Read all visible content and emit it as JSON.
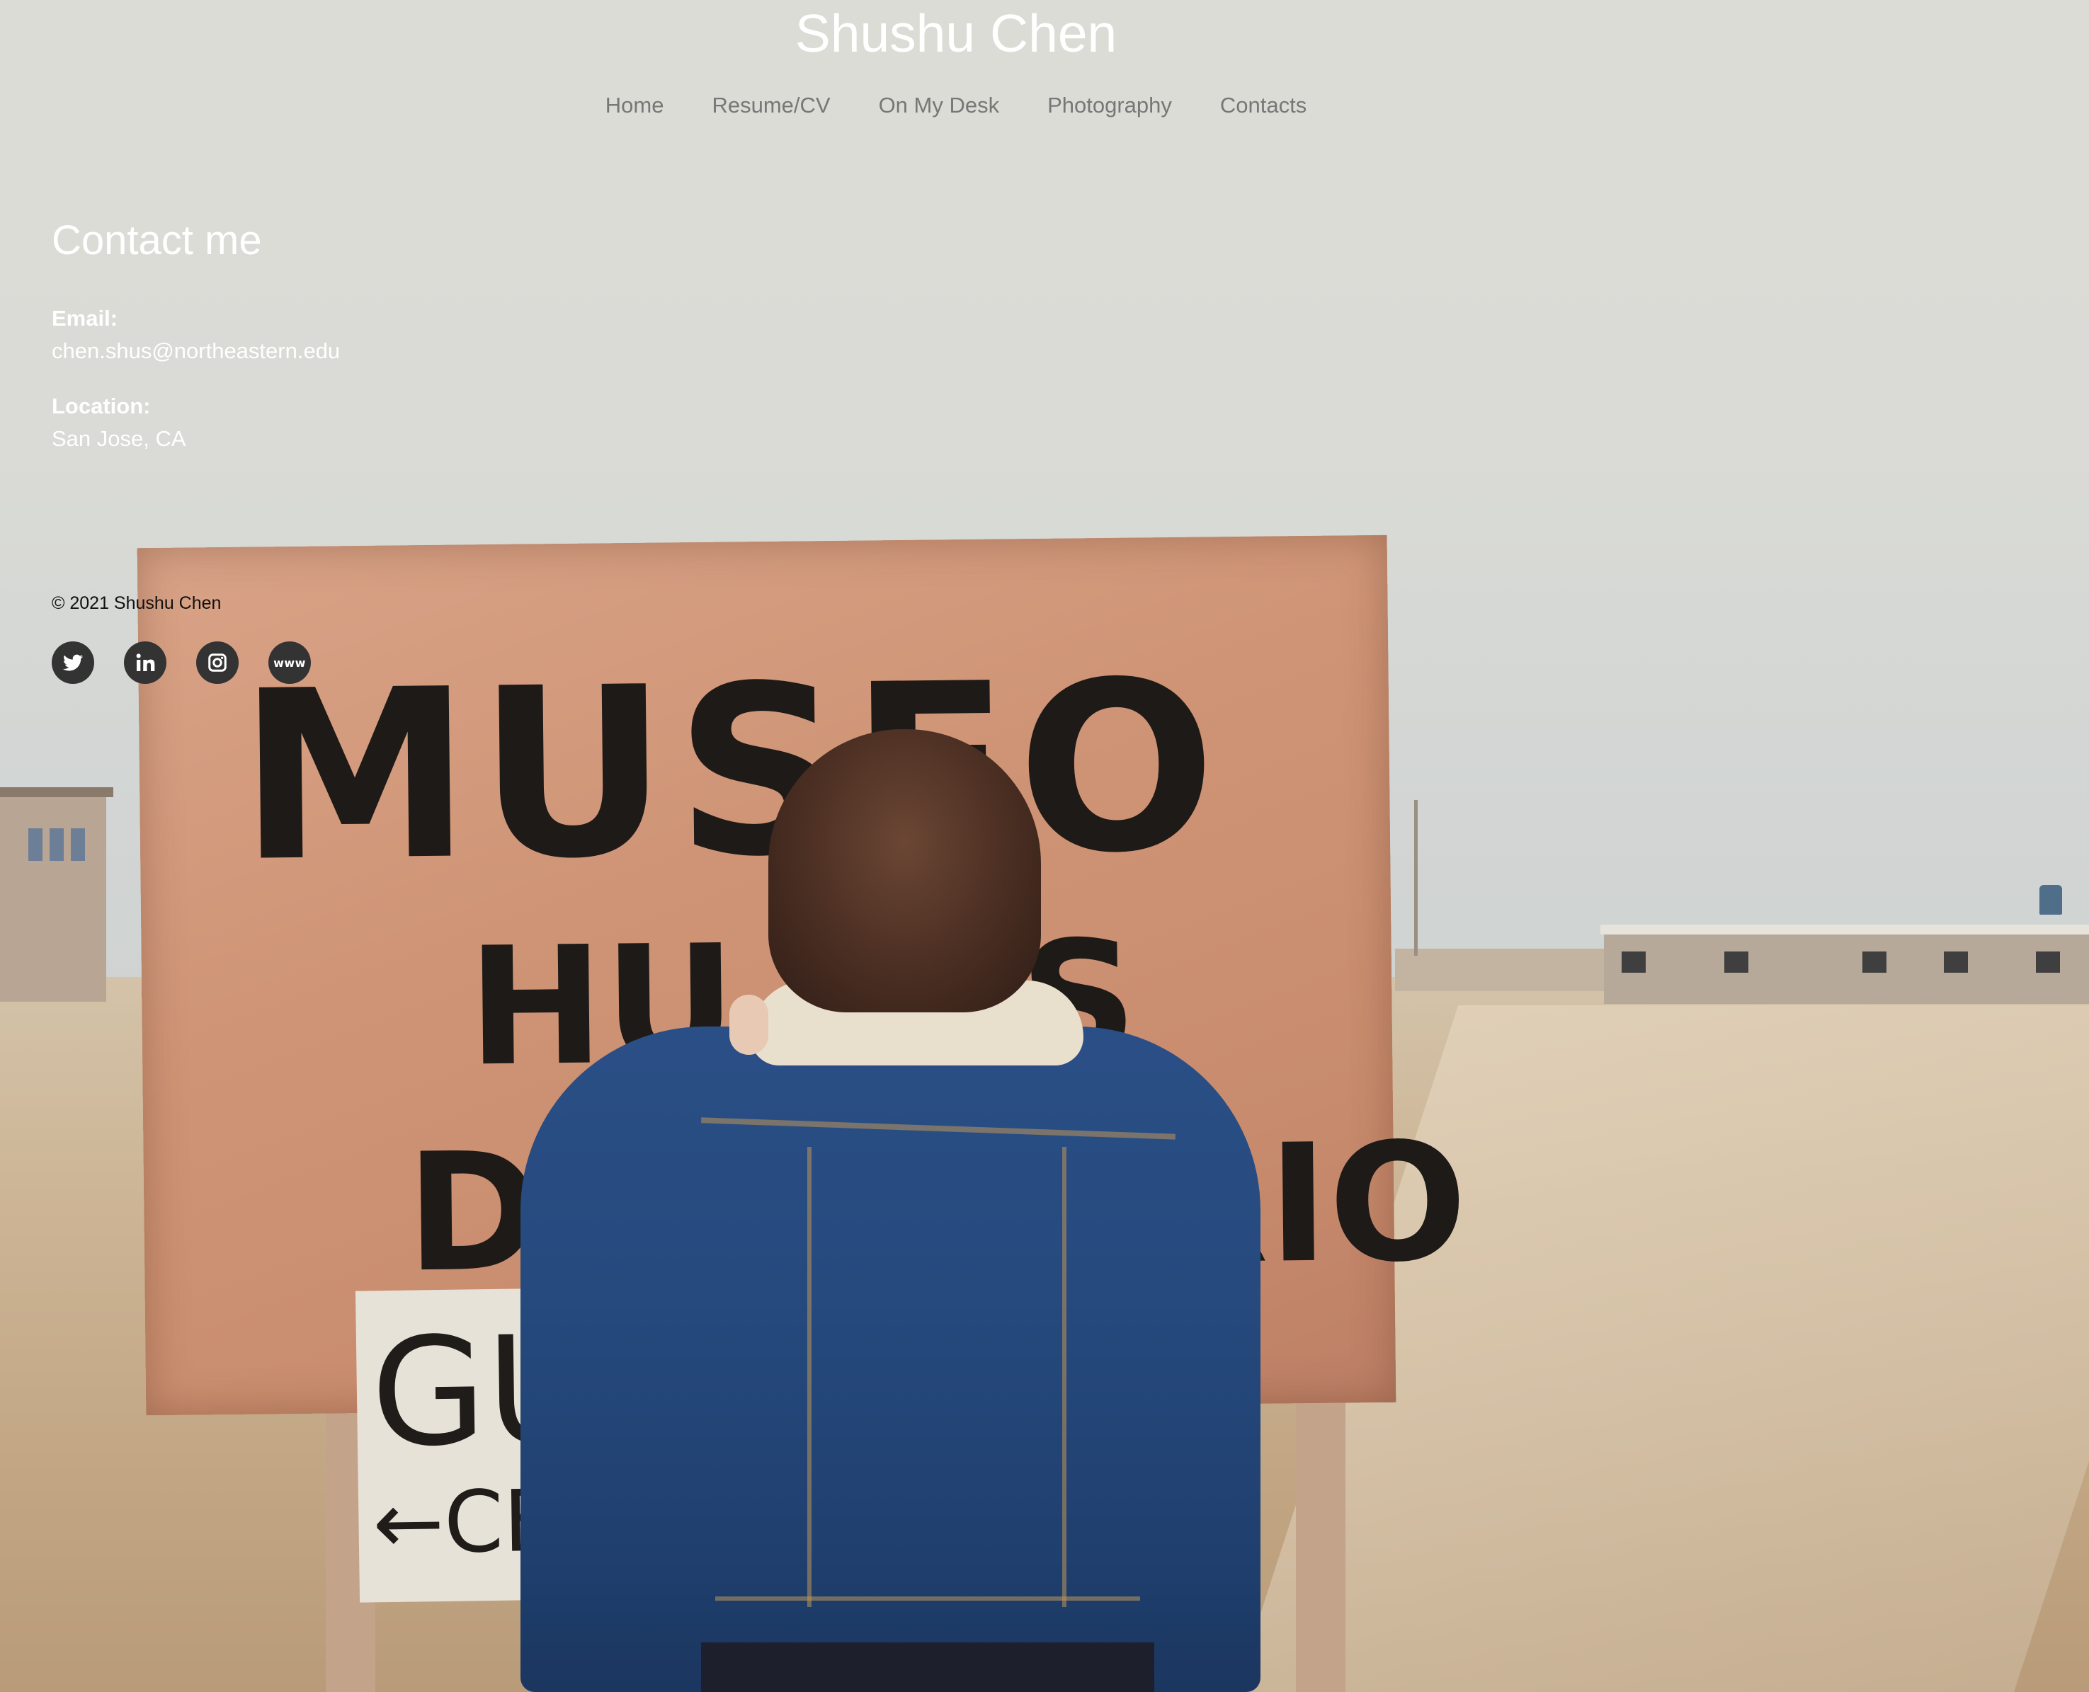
{
  "site": {
    "title": "Shushu Chen"
  },
  "nav": {
    "items": [
      {
        "label": "Home"
      },
      {
        "label": "Resume/CV"
      },
      {
        "label": "On My Desk"
      },
      {
        "label": "Photography"
      },
      {
        "label": "Contacts"
      }
    ]
  },
  "contact": {
    "heading": "Contact me",
    "email_label": "Email:",
    "email_value": "chen.shus@northeastern.edu",
    "location_label": "Location:",
    "location_value": "San Jose, CA"
  },
  "footer": {
    "copyright": "© 2021 Shushu Chen",
    "social": [
      {
        "icon": "twitter-icon"
      },
      {
        "icon": "linkedin-icon"
      },
      {
        "icon": "instagram-icon"
      },
      {
        "icon": "website-icon",
        "text": "www"
      }
    ]
  },
  "background": {
    "sign_text": {
      "line1": "MUSEO",
      "line2a": "HU",
      "line2b": "S",
      "line3a": "DE",
      "line3b": "RIO",
      "small_line1": "GUIA",
      "small_line2": "←CE 72"
    }
  }
}
